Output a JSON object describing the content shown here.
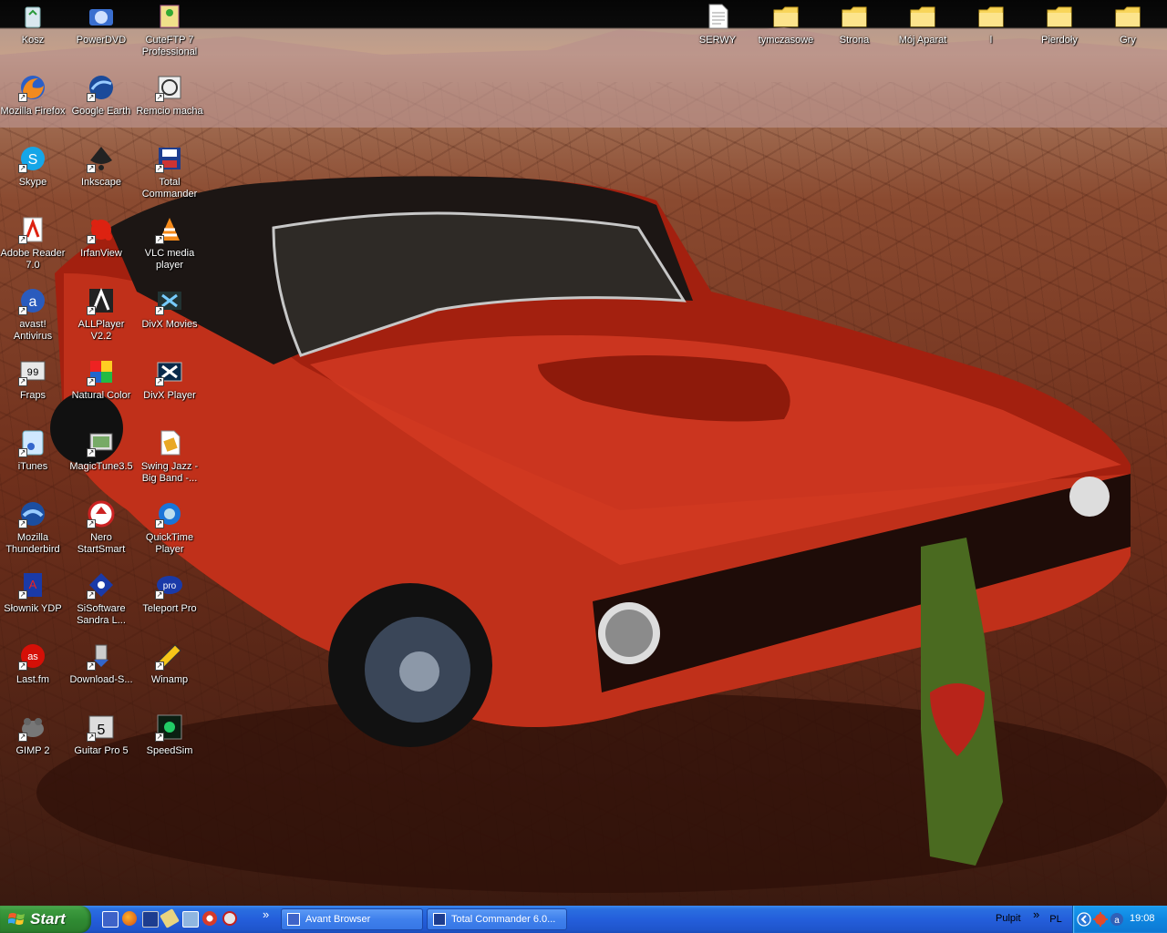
{
  "desktop": {
    "icons": [
      {
        "label": "Kosz",
        "icon": "recycle-bin-icon"
      },
      {
        "label": "PowerDVD",
        "icon": "powerdvd-icon"
      },
      {
        "label": "CuteFTP 7\nProfessional",
        "icon": "cuteftp-icon"
      },
      {
        "label": "Mozilla Firefox",
        "icon": "firefox-icon"
      },
      {
        "label": "Google Earth",
        "icon": "google-earth-icon"
      },
      {
        "label": "Remcio macha",
        "icon": "remcio-icon"
      },
      {
        "label": "Skype",
        "icon": "skype-icon"
      },
      {
        "label": "Inkscape",
        "icon": "inkscape-icon"
      },
      {
        "label": "Total\nCommander",
        "icon": "total-commander-icon"
      },
      {
        "label": "Adobe Reader\n7.0",
        "icon": "adobe-reader-icon"
      },
      {
        "label": "IrfanView",
        "icon": "irfanview-icon"
      },
      {
        "label": "VLC media\nplayer",
        "icon": "vlc-icon"
      },
      {
        "label": "avast!\nAntivirus",
        "icon": "avast-icon"
      },
      {
        "label": "ALLPlayer\nV2.2",
        "icon": "allplayer-icon"
      },
      {
        "label": "DivX Movies",
        "icon": "divx-movies-icon"
      },
      {
        "label": "Fraps",
        "icon": "fraps-icon"
      },
      {
        "label": "Natural Color",
        "icon": "natural-color-icon"
      },
      {
        "label": "DivX Player",
        "icon": "divx-player-icon"
      },
      {
        "label": "iTunes",
        "icon": "itunes-icon"
      },
      {
        "label": "MagicTune3.5",
        "icon": "magictune-icon"
      },
      {
        "label": "Swing Jazz -\nBig Band -...",
        "icon": "audio-file-icon"
      },
      {
        "label": "Mozilla\nThunderbird",
        "icon": "thunderbird-icon"
      },
      {
        "label": "Nero\nStartSmart",
        "icon": "nero-icon"
      },
      {
        "label": "QuickTime\nPlayer",
        "icon": "quicktime-icon"
      },
      {
        "label": "Słownik YDP",
        "icon": "dictionary-icon"
      },
      {
        "label": "SiSoftware\nSandra L...",
        "icon": "sisoftware-icon"
      },
      {
        "label": "Teleport Pro",
        "icon": "teleport-pro-icon"
      },
      {
        "label": "Last.fm",
        "icon": "lastfm-icon"
      },
      {
        "label": "Download-S...",
        "icon": "download-icon"
      },
      {
        "label": "Winamp",
        "icon": "winamp-icon"
      },
      {
        "label": "GIMP 2",
        "icon": "gimp-icon"
      },
      {
        "label": "Guitar Pro 5",
        "icon": "guitar-pro-icon"
      },
      {
        "label": "SpeedSim",
        "icon": "speedsim-icon"
      }
    ],
    "top_icons": [
      {
        "label": "SERWY",
        "icon": "text-file-icon"
      },
      {
        "label": "tymczasowe",
        "icon": "folder-icon"
      },
      {
        "label": "Strona",
        "icon": "folder-icon"
      },
      {
        "label": "Mój Aparat",
        "icon": "folder-icon"
      },
      {
        "label": "l",
        "icon": "folder-icon"
      },
      {
        "label": "Pierdoły",
        "icon": "folder-icon"
      },
      {
        "label": "Gry",
        "icon": "folder-icon"
      }
    ]
  },
  "taskbar": {
    "start_label": "Start",
    "quick_launch": [
      "avant-browser-icon",
      "firefox-icon",
      "save-icon",
      "cuteftp-icon",
      "show-desktop-icon",
      "opera-icon"
    ],
    "quick_launch_more": "»",
    "tasks": [
      {
        "label": "Avant Browser",
        "icon": "avant-browser-icon"
      },
      {
        "label": "Total Commander 6.0...",
        "icon": "total-commander-icon"
      }
    ],
    "toolbar_label": "Pulpit",
    "toolbar_more": "»",
    "language": "PL",
    "clock": "19:08",
    "colors": {
      "taskbar": "#245edb",
      "start": "#3c9a3e",
      "tray": "#0e86e0"
    }
  }
}
